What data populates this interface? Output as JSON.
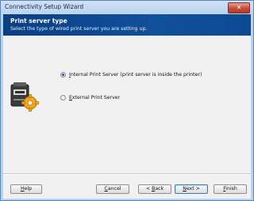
{
  "window": {
    "title": "Connectivity Setup Wizard",
    "close_glyph": "✕"
  },
  "banner": {
    "heading": "Print server type",
    "subtitle": "Select the type of wired print server you are setting up."
  },
  "options": [
    {
      "label_first": "I",
      "label_rest": "nternal Print Server (print server is inside the printer)",
      "selected": true
    },
    {
      "label_first": "E",
      "label_rest": "xternal Print Server",
      "selected": false
    }
  ],
  "buttons": {
    "help": {
      "first": "H",
      "rest": "elp"
    },
    "cancel": {
      "first": "C",
      "rest": "ancel"
    },
    "back": {
      "prefix": "< ",
      "first": "B",
      "rest": "ack"
    },
    "next": {
      "first": "N",
      "rest": "ext >"
    },
    "finish": {
      "first": "F",
      "rest": "inish"
    }
  },
  "icons": {
    "printer": "printer-icon",
    "gear": "gear-icon"
  },
  "colors": {
    "banner": "#0f4b93",
    "accent": "#f0a81c"
  }
}
